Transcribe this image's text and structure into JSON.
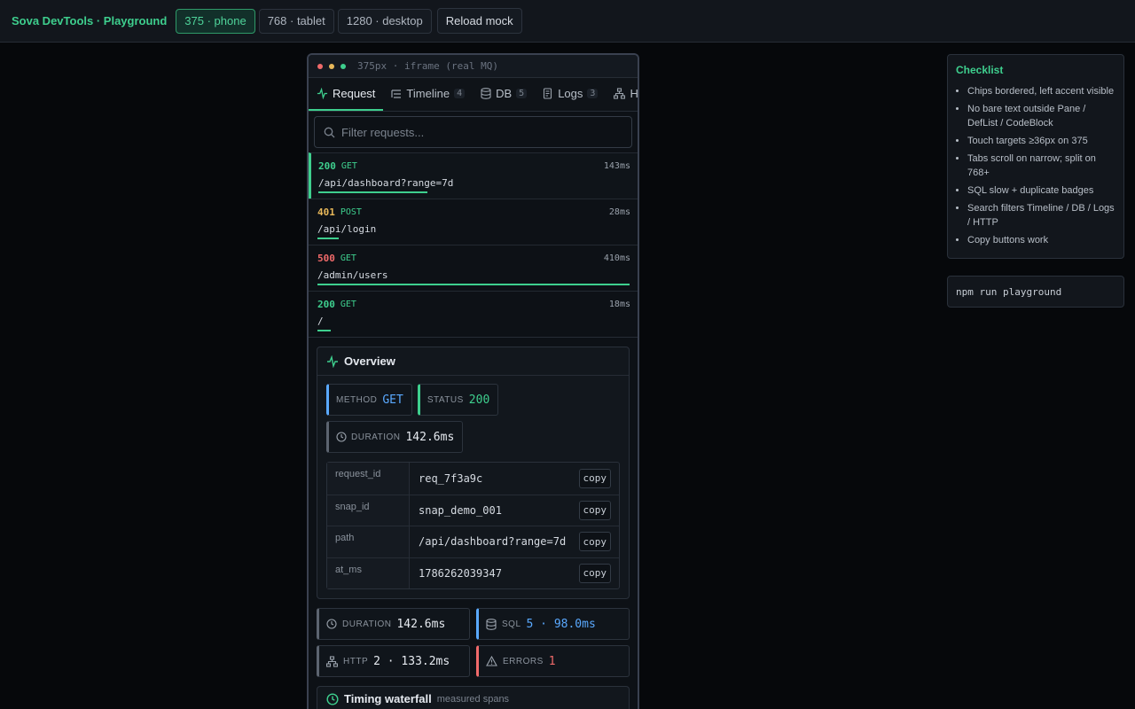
{
  "app": {
    "title": "Sova DevTools · Playground"
  },
  "viewports": [
    {
      "label": "375 · phone",
      "active": true
    },
    {
      "label": "768 · tablet",
      "active": false
    },
    {
      "label": "1280 · desktop",
      "active": false
    }
  ],
  "reload_label": "Reload mock",
  "frame": {
    "label": "375px · iframe (real MQ)",
    "dots": [
      "#f06a6a",
      "#e8b85a",
      "#3ecf8e"
    ]
  },
  "tabs": [
    {
      "label": "Request",
      "icon": "pulse-icon",
      "count": ""
    },
    {
      "label": "Timeline",
      "icon": "list-icon",
      "count": "4"
    },
    {
      "label": "DB",
      "icon": "database-icon",
      "count": "5"
    },
    {
      "label": "Logs",
      "icon": "scroll-icon",
      "count": "3"
    },
    {
      "label": "HTTP",
      "icon": "network-icon",
      "count": ""
    }
  ],
  "search": {
    "placeholder": "Filter requests..."
  },
  "requests": [
    {
      "status": "200",
      "method": "GET",
      "duration": "143ms",
      "path": "/api/dashboard?range=7d",
      "status_color": "#3ecf8e",
      "bar_fraction": 0.349
    },
    {
      "status": "401",
      "method": "POST",
      "duration": "28ms",
      "path": "/api/login",
      "status_color": "#e8b85a",
      "bar_fraction": 0.068
    },
    {
      "status": "500",
      "method": "GET",
      "duration": "410ms",
      "path": "/admin/users",
      "status_color": "#f06a6a",
      "bar_fraction": 1.0
    },
    {
      "status": "200",
      "method": "GET",
      "duration": "18ms",
      "path": "/",
      "status_color": "#3ecf8e",
      "bar_fraction": 0.044
    }
  ],
  "overview": {
    "title": "Overview",
    "chips": {
      "method": {
        "key": "METHOD",
        "value": "GET"
      },
      "status": {
        "key": "STATUS",
        "value": "200"
      },
      "duration": {
        "key": "DURATION",
        "value": "142.6ms"
      }
    },
    "deflist": [
      {
        "key": "request_id",
        "value": "req_7f3a9c"
      },
      {
        "key": "snap_id",
        "value": "snap_demo_001"
      },
      {
        "key": "path",
        "value": "/api/dashboard?range=7d"
      },
      {
        "key": "at_ms",
        "value": "1786262039347"
      }
    ],
    "copy_label": "copy"
  },
  "stats": {
    "duration": {
      "key": "DURATION",
      "value": "142.6ms"
    },
    "sql": {
      "key": "SQL",
      "value": "5 · 98.0ms"
    },
    "http": {
      "key": "HTTP",
      "value": "2 · 133.2ms"
    },
    "errors": {
      "key": "ERRORS",
      "value": "1"
    }
  },
  "waterfall": {
    "title": "Timing waterfall",
    "subtitle": "measured spans"
  },
  "checklist": {
    "title": "Checklist",
    "items": [
      "Chips bordered, left accent visible",
      "No bare text outside Pane / DefList / CodeBlock",
      "Touch targets ≥36px on 375",
      "Tabs scroll on narrow; split on 768+",
      "SQL slow + duplicate badges",
      "Search filters Timeline / DB / Logs / HTTP",
      "Copy buttons work"
    ]
  },
  "command": "npm run playground",
  "colors": {
    "accent": "#3ecf8e",
    "blue": "#5aa9ff",
    "red": "#f06a6a",
    "amber": "#e8b85a"
  }
}
